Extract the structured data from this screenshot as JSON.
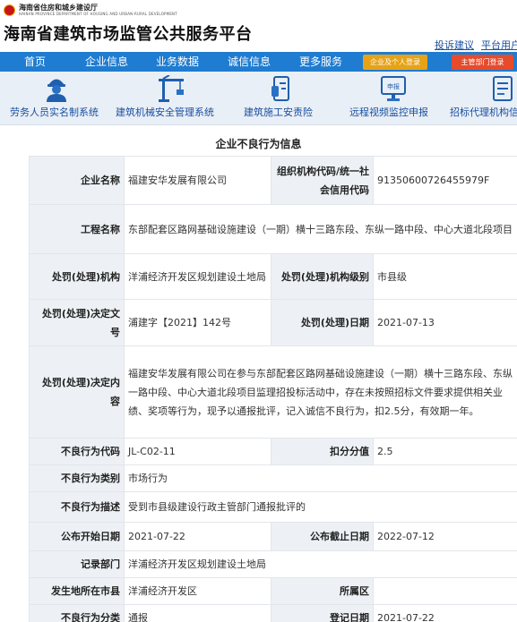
{
  "header": {
    "org_name": "海南省住房和城乡建设厅",
    "org_sub": "HAINAN PROVINCE DEPARTMENT OF HOUSING AND URBAN-RURAL DEVELOPMENT",
    "site_title": "海南省建筑市场监管公共服务平台",
    "links": [
      "投诉建议",
      "平台用户"
    ]
  },
  "nav": {
    "items": [
      "首页",
      "企业信息",
      "业务数据",
      "诚信信息",
      "更多服务"
    ],
    "login_enterprise": "企业及个人登录",
    "login_admin": "主管部门登录",
    "colors": {
      "bar": "#1f7cd0",
      "login_enterprise": "#e6a318",
      "login_admin": "#e64b2c"
    }
  },
  "systems": [
    {
      "label": "劳务人员实名制系统",
      "icon": "worker-icon"
    },
    {
      "label": "建筑机械安全管理系统",
      "icon": "crane-icon"
    },
    {
      "label": "建筑施工安责险",
      "icon": "insurance-icon"
    },
    {
      "label": "远程视频监控申报",
      "icon": "monitor-icon"
    },
    {
      "label": "招标代理机构信",
      "icon": "document-icon"
    }
  ],
  "section_title": "企业不良行为信息",
  "record": {
    "company_name_label": "企业名称",
    "company_name": "福建安华发展有限公司",
    "org_code_label": "组织机构代码/统一社会信用代码",
    "org_code": "91350600726455979F",
    "project_label": "工程名称",
    "project": "东部配套区路网基础设施建设（一期）横十三路东段、东纵一路中段、中心大道北段项目",
    "authority_label": "处罚(处理)机构",
    "authority": "洋浦经济开发区规划建设土地局",
    "authority_level_label": "处罚(处理)机构级别",
    "authority_level": "市县级",
    "decision_no_label": "处罚(处理)决定文号",
    "decision_no": "浦建字【2021】142号",
    "decision_date_label": "处罚(处理)日期",
    "decision_date": "2021-07-13",
    "decision_content_label": "处罚(处理)决定内容",
    "decision_content": "福建安华发展有限公司在参与东部配套区路网基础设施建设（一期）横十三路东段、东纵一路中段、中心大道北段项目监理招投标活动中，存在未按照招标文件要求提供相关业绩、奖项等行为，现予以通报批评，记入诚信不良行为，扣2.5分，有效期一年。",
    "bad_code_label": "不良行为代码",
    "bad_code": "JL-C02-11",
    "deduct_label": "扣分分值",
    "deduct": "2.5",
    "category_label": "不良行为类别",
    "category": "市场行为",
    "desc_label": "不良行为描述",
    "desc": "受到市县级建设行政主管部门通报批评的",
    "pub_start_label": "公布开始日期",
    "pub_start": "2021-07-22",
    "pub_end_label": "公布截止日期",
    "pub_end": "2022-07-12",
    "record_dept_label": "记录部门",
    "record_dept": "洋浦经济开发区规划建设土地局",
    "city_label": "发生地所在市县",
    "city": "洋浦经济开发区",
    "district_label": "所属区",
    "district": "",
    "class_label": "不良行为分类",
    "class": "通报",
    "reg_date_label": "登记日期",
    "reg_date": "2021-07-22"
  }
}
